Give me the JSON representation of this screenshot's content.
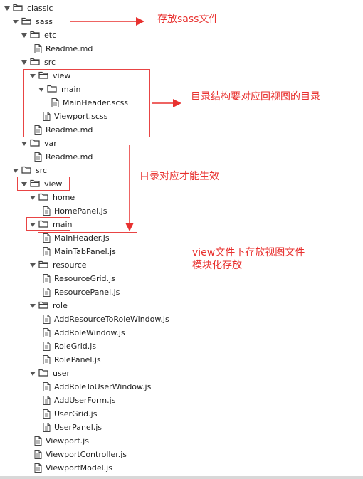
{
  "tree": [
    {
      "label": "classic",
      "kind": "folder",
      "depth": 0
    },
    {
      "label": "sass",
      "kind": "folder",
      "depth": 1
    },
    {
      "label": "etc",
      "kind": "folder",
      "depth": 2
    },
    {
      "label": "Readme.md",
      "kind": "file",
      "depth": 3
    },
    {
      "label": "src",
      "kind": "folder",
      "depth": 2
    },
    {
      "label": "view",
      "kind": "folder",
      "depth": 3
    },
    {
      "label": "main",
      "kind": "folder",
      "depth": 4
    },
    {
      "label": "MainHeader.scss",
      "kind": "file",
      "depth": 5
    },
    {
      "label": "Viewport.scss",
      "kind": "file",
      "depth": 4
    },
    {
      "label": "Readme.md",
      "kind": "file",
      "depth": 3
    },
    {
      "label": "var",
      "kind": "folder",
      "depth": 2
    },
    {
      "label": "Readme.md",
      "kind": "file",
      "depth": 3
    },
    {
      "label": "src",
      "kind": "folder",
      "depth": 1
    },
    {
      "label": "view",
      "kind": "folder",
      "depth": 2
    },
    {
      "label": "home",
      "kind": "folder",
      "depth": 3
    },
    {
      "label": "HomePanel.js",
      "kind": "file",
      "depth": 4
    },
    {
      "label": "main",
      "kind": "folder",
      "depth": 3
    },
    {
      "label": "MainHeader.js",
      "kind": "file",
      "depth": 4
    },
    {
      "label": "MainTabPanel.js",
      "kind": "file",
      "depth": 4
    },
    {
      "label": "resource",
      "kind": "folder",
      "depth": 3
    },
    {
      "label": "ResourceGrid.js",
      "kind": "file",
      "depth": 4
    },
    {
      "label": "ResourcePanel.js",
      "kind": "file",
      "depth": 4
    },
    {
      "label": "role",
      "kind": "folder",
      "depth": 3
    },
    {
      "label": "AddResourceToRoleWindow.js",
      "kind": "file",
      "depth": 4
    },
    {
      "label": "AddRoleWindow.js",
      "kind": "file",
      "depth": 4
    },
    {
      "label": "RoleGrid.js",
      "kind": "file",
      "depth": 4
    },
    {
      "label": "RolePanel.js",
      "kind": "file",
      "depth": 4
    },
    {
      "label": "user",
      "kind": "folder",
      "depth": 3
    },
    {
      "label": "AddRoleToUserWindow.js",
      "kind": "file",
      "depth": 4
    },
    {
      "label": "AddUserForm.js",
      "kind": "file",
      "depth": 4
    },
    {
      "label": "UserGrid.js",
      "kind": "file",
      "depth": 4
    },
    {
      "label": "UserPanel.js",
      "kind": "file",
      "depth": 4
    },
    {
      "label": "Viewport.js",
      "kind": "file",
      "depth": 3
    },
    {
      "label": "ViewportController.js",
      "kind": "file",
      "depth": 3
    },
    {
      "label": "ViewportModel.js",
      "kind": "file",
      "depth": 3
    }
  ],
  "annotations": {
    "sass_note": "存放sass文件",
    "structure_note": "目录结构要对应回视图的目录",
    "mapping_note": "目录对应才能生效",
    "view_note_line1": "view文件下存放视图文件",
    "view_note_line2": "模块化存放"
  },
  "colors": {
    "annotation": "#e8312f",
    "folder_icon": "#3b3b3b",
    "file_icon": "#444444"
  }
}
